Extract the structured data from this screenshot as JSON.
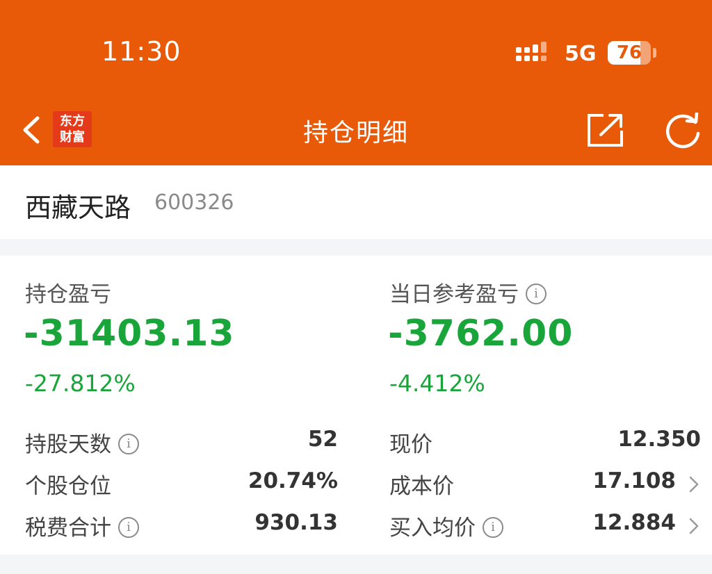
{
  "status_bar": {
    "time": "11:30",
    "network": "5G",
    "battery": "76",
    "battery_level": 0.76
  },
  "header": {
    "back_icon": "chevron-left-icon",
    "logo_line1": "东方",
    "logo_line2": "财富",
    "title": "持仓明细",
    "share_icon": "share-icon",
    "refresh_icon": "refresh-icon"
  },
  "stock": {
    "name": "西藏天路",
    "code": "600326"
  },
  "summary": {
    "position_pl_label": "持仓盈亏",
    "position_pl_value": "-31403.13",
    "position_pl_pct": "-27.812%",
    "daily_pl_label": "当日参考盈亏",
    "daily_pl_value": "-3762.00",
    "daily_pl_pct": "-4.412%"
  },
  "details": {
    "left": [
      {
        "label": "持股天数",
        "value": "52",
        "info": true
      },
      {
        "label": "个股仓位",
        "value": "20.74%",
        "info": false
      },
      {
        "label": "税费合计",
        "value": "930.13",
        "info": true
      }
    ],
    "right": [
      {
        "label": "现价",
        "value": "12.350",
        "info": false,
        "chevron": false
      },
      {
        "label": "成本价",
        "value": "17.108",
        "info": false,
        "chevron": true
      },
      {
        "label": "买入均价",
        "value": "12.884",
        "info": true,
        "chevron": true
      }
    ]
  },
  "colors": {
    "brand": "#e85a08",
    "loss": "#1aa53a"
  }
}
